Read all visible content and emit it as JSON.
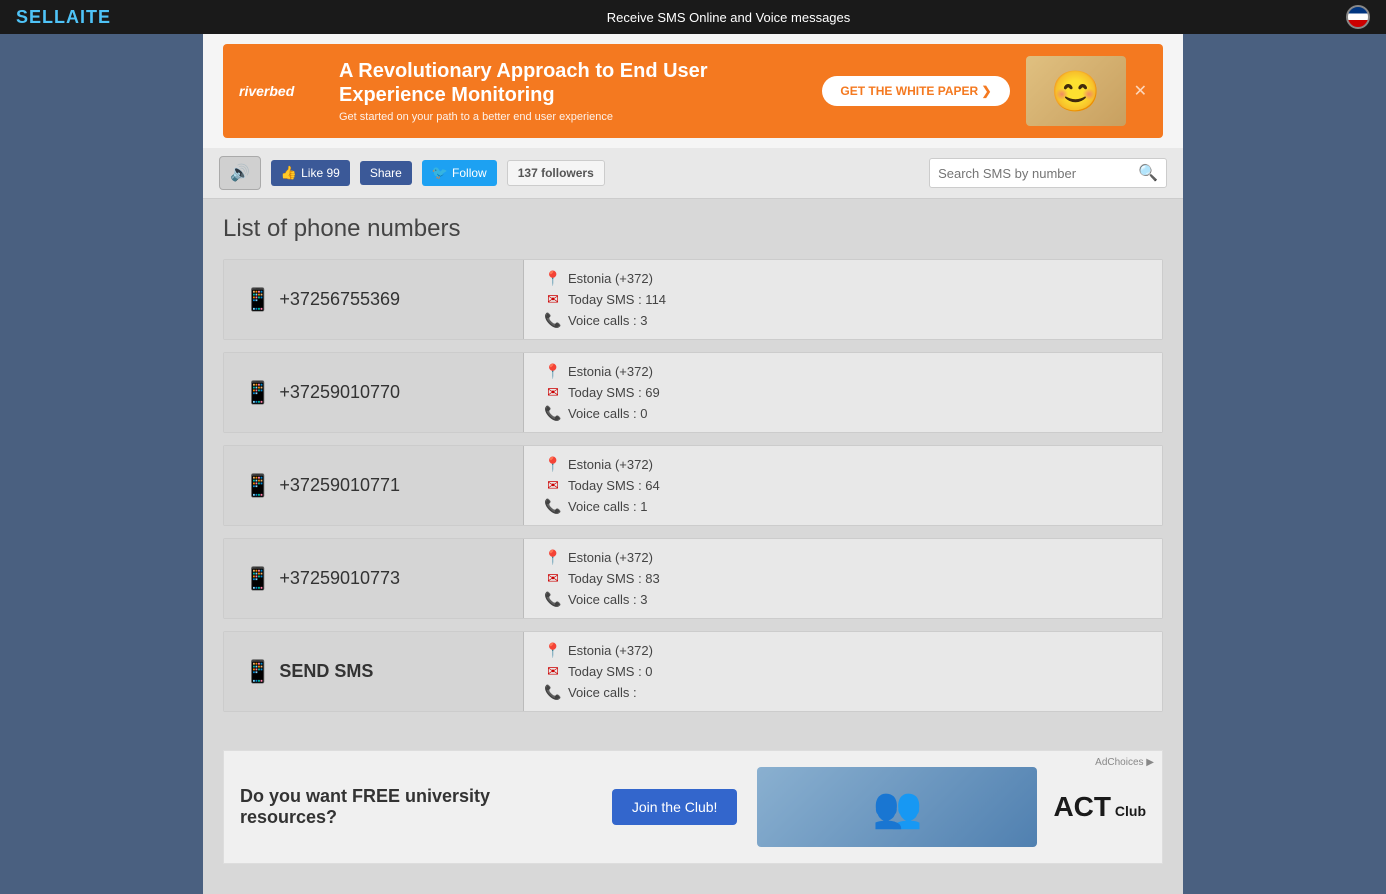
{
  "topbar": {
    "logo_part1": "SELL",
    "logo_part2": "A",
    "logo_part3": "ITE",
    "tagline": "Receive SMS Online and Voice messages"
  },
  "ad_top": {
    "brand": "riverbed",
    "headline": "A Revolutionary Approach to End User Experience Monitoring",
    "subtext": "Get started on your path to a better end user experience",
    "cta_label": "GET THE WHITE PAPER ❯"
  },
  "toolbar": {
    "sound_icon": "🔊",
    "like_label": "Like 99",
    "share_label": "Share",
    "follow_label": "Follow",
    "followers_count": "137",
    "followers_label": "followers",
    "search_placeholder": "Search SMS by number"
  },
  "page_title": "List of phone numbers",
  "phone_numbers": [
    {
      "number": "+37256755369",
      "country": "Estonia (+372)",
      "sms_label": "Today SMS : 114",
      "voice_label": "Voice calls : 3"
    },
    {
      "number": "+37259010770",
      "country": "Estonia (+372)",
      "sms_label": "Today SMS : 69",
      "voice_label": "Voice calls : 0"
    },
    {
      "number": "+37259010771",
      "country": "Estonia (+372)",
      "sms_label": "Today SMS : 64",
      "voice_label": "Voice calls : 1"
    },
    {
      "number": "+37259010773",
      "country": "Estonia (+372)",
      "sms_label": "Today SMS : 83",
      "voice_label": "Voice calls : 3"
    }
  ],
  "send_sms_row": {
    "label": "SEND SMS",
    "country": "Estonia (+372)",
    "sms_label": "Today SMS : 0",
    "voice_label": "Voice calls :"
  },
  "ad_bottom": {
    "question": "Do you want FREE university resources?",
    "cta_label": "Join the Club!",
    "brand_name": "ACT Club",
    "ad_choices": "AdChoices ▶"
  }
}
